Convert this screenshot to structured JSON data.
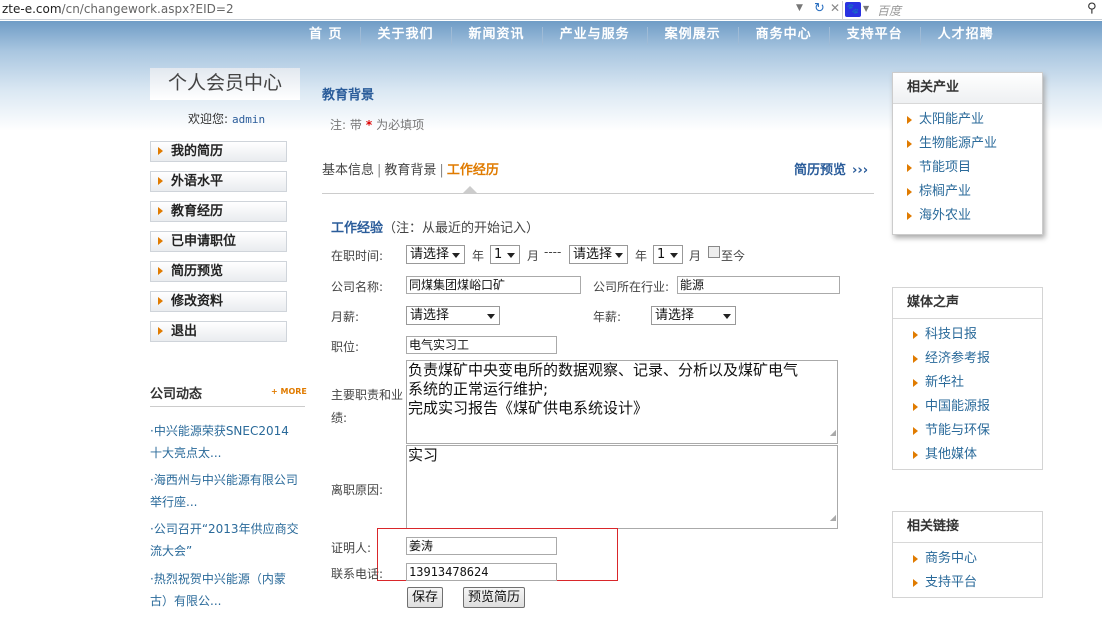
{
  "browser": {
    "url_host": "zte-e.com",
    "url_path": "/cn/changework.aspx?EID=2",
    "search_placeholder": "百度",
    "search_logo": "🐾"
  },
  "nav": [
    "首 页",
    "关于我们",
    "新闻资讯",
    "产业与服务",
    "案例展示",
    "商务中心",
    "支持平台",
    "人才招聘"
  ],
  "left": {
    "title": "个人会员中心",
    "welcome_label": "欢迎您:",
    "username": "admin",
    "menu": [
      "我的简历",
      "外语水平",
      "教育经历",
      "已申请职位",
      "简历预览",
      "修改资料",
      "退出"
    ],
    "news_heading": "公司动态",
    "news_more": "+ MORE",
    "news": [
      "·中兴能源荣获SNEC2014十大亮点太...",
      "·海西州与中兴能源有限公司举行座...",
      "·公司召开“2013年供应商交流大会”",
      "·热烈祝贺中兴能源（内蒙古）有限公..."
    ]
  },
  "main": {
    "section_title": "教育背景",
    "note_prefix": "注: 带",
    "note_star": "*",
    "note_suffix": "为必填项",
    "tabs": [
      "基本信息",
      "教育背景",
      "工作经历"
    ],
    "tab_sep": "|",
    "preview_link": "简历预览",
    "preview_chev": "›››",
    "work_title": "工作经验",
    "work_hint": "（注：从最近的开始记入）",
    "period_label": "在职时间:",
    "start_year": "请选择",
    "year_unit": "年",
    "start_month": "1",
    "month_unit": "月",
    "range_sep": "----",
    "end_year": "请选择",
    "end_month": "1",
    "till_now": "至今",
    "company_label": "公司名称:",
    "company_value": "同煤集团煤峪口矿",
    "industry_label": "公司所在行业:",
    "industry_value": "能源",
    "monthly_label": "月薪:",
    "monthly_value": "请选择",
    "annual_label": "年薪:",
    "annual_value": "请选择",
    "position_label": "职位:",
    "position_value": "电气实习工",
    "duties_label": "主要职责和业绩:",
    "duties_lines": [
      "负责煤矿中央变电所的数据观察、记录、分析以及煤矿电气",
      "系统的正常运行维护;",
      "完成实习报告《煤矿供电系统设计》"
    ],
    "leave_label": "离职原因:",
    "leave_value": "实习",
    "reference_label": "证明人:",
    "reference_value": "姜涛",
    "phone_label": "联系电话:",
    "phone_value": "13913478624",
    "save_button": "保存",
    "preview_button": "预览简历"
  },
  "right": {
    "industries_title": "相关产业",
    "industries": [
      "太阳能产业",
      "生物能源产业",
      "节能项目",
      "棕榈产业",
      "海外农业"
    ],
    "media_title": "媒体之声",
    "media": [
      "科技日报",
      "经济参考报",
      "新华社",
      "中国能源报",
      "节能与环保",
      "其他媒体"
    ],
    "links_title": "相关链接",
    "links": [
      "商务中心",
      "支持平台"
    ]
  },
  "colors": {
    "accent": "#e07b00",
    "link": "#2a5c9a",
    "highlight": "#d9262a"
  }
}
